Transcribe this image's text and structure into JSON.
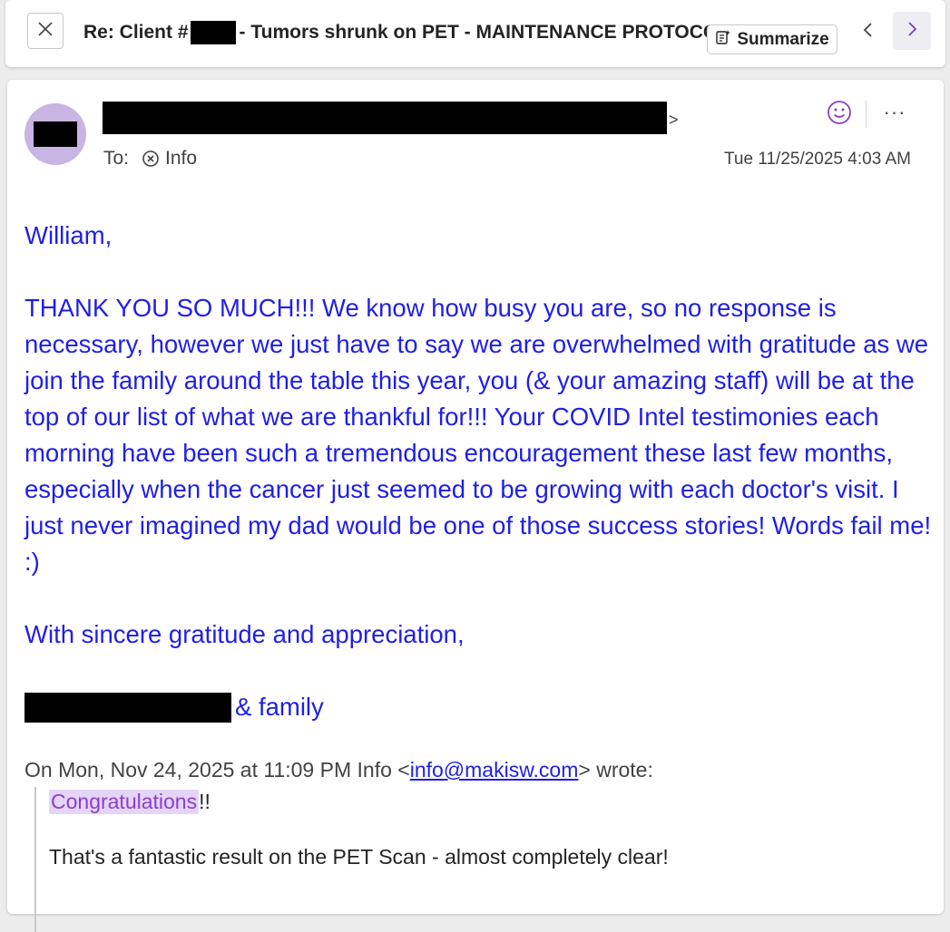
{
  "header": {
    "subject_prefix": "Re: Client #",
    "subject_suffix": "- Tumors shrunk on PET - MAINTENANCE PROTOCOL",
    "summarize_label": "Summarize",
    "prev_icon": "chevron-left-icon",
    "next_icon": "chevron-right-icon",
    "close_icon": "close-icon"
  },
  "message": {
    "sender_chevron": ">",
    "to_label": "To:",
    "recipient": "Info",
    "timestamp": "Tue 11/25/2025 4:03 AM",
    "more_label": "···",
    "body": {
      "greeting": "William,",
      "paragraph": "THANK YOU SO MUCH!!! We know how busy you are, so no response is necessary, however we just have to say we are overwhelmed with gratitude as we join the family around the table this year, you (& your amazing staff) will be at the top of our list of what we are thankful for!!! Your COVID Intel testimonies each morning have been such a tremendous encouragement these last few months, especially when the cancer just seemed to be growing with each doctor's visit. I just never imagined my dad would be one of those success stories! Words fail me! :)",
      "closing": "With sincere gratitude and appreciation,",
      "signature_suffix": "& family"
    },
    "quoted": {
      "header_prefix": "On Mon, Nov 24, 2025 at 11:09 PM Info <",
      "email": "info@makisw.com",
      "header_suffix": "> wrote:",
      "highlight_word": "Congratulations",
      "line1_suffix": "!!",
      "line2": "That's a fantastic result on the PET Scan - almost completely clear!"
    }
  },
  "colors": {
    "body_text": "#1f1fe6",
    "avatar_bg": "#c8b5e3",
    "accent": "#8a3fc9",
    "highlight_bg": "#e4d5f7"
  }
}
